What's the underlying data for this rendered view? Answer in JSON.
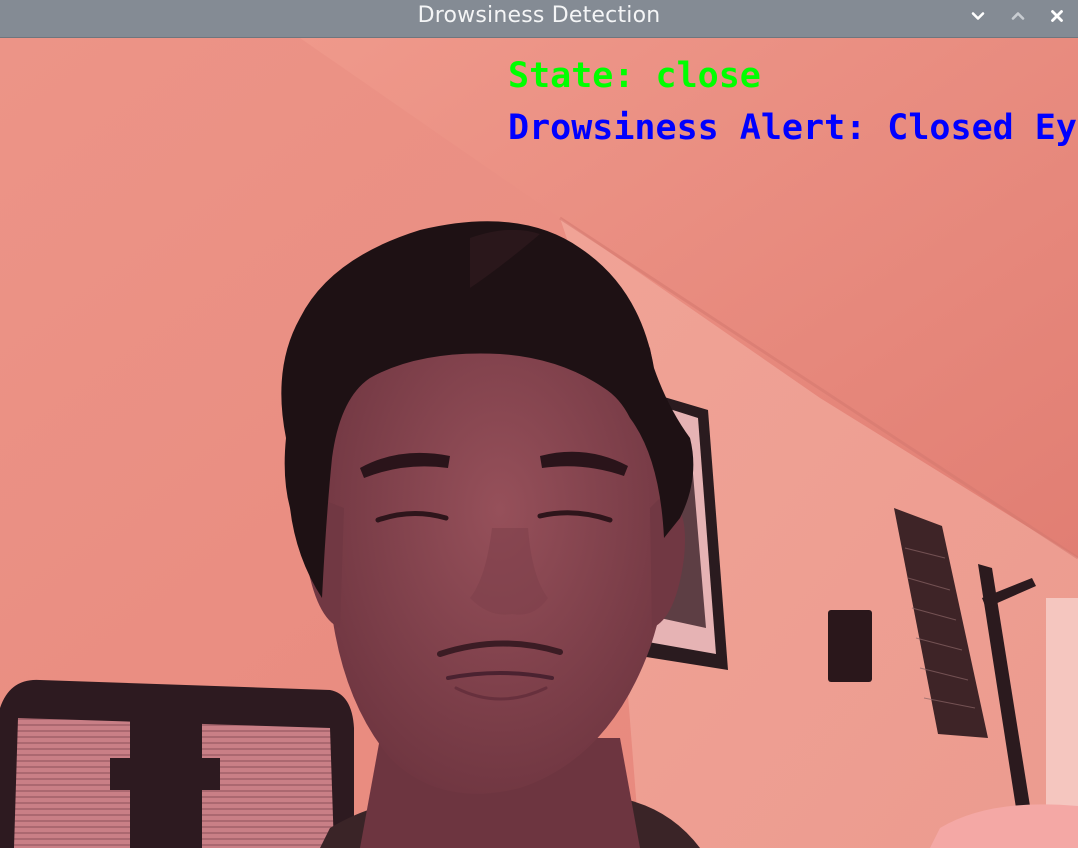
{
  "window": {
    "title": "Drowsiness Detection",
    "controls": {
      "minimize_icon": "chevron-down-icon",
      "maximize_icon": "chevron-up-icon",
      "close_icon": "close-icon"
    }
  },
  "overlay": {
    "state_text": "State: close",
    "state_color": "#00ff00",
    "alert_text": "Drowsiness Alert: Closed Eyes",
    "alert_color": "#0000ff"
  },
  "colors": {
    "titlebar_bg": "#848b94",
    "titlebar_text": "#f4f5f6",
    "scene_tint": "#e98b80"
  }
}
